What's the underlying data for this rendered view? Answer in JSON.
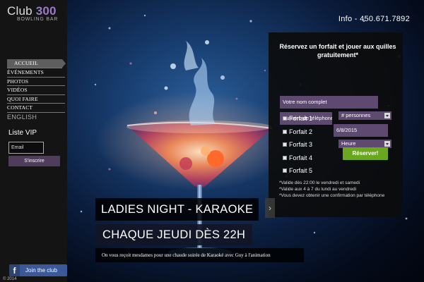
{
  "logo": {
    "name": "Club",
    "number": "300",
    "tagline": "BOWLING BAR"
  },
  "nav": {
    "items": [
      "ACCUEIL",
      "ÉVÉNEMENTS",
      "PHOTOS",
      "VIDÉOS",
      "QUOI FAIRE",
      "CONTACT"
    ],
    "english": "ENGLISH"
  },
  "vip": {
    "title": "Liste VIP",
    "email_placeholder": "Email",
    "submit": "S'inscrire"
  },
  "facebook": {
    "label": "Join the club",
    "icon": "facebook-icon"
  },
  "footer": {
    "copyright": "© 2014"
  },
  "header": {
    "info": "Info - 450.671.7892"
  },
  "reservation": {
    "title": "Réservez un forfait et jouer aux quilles gratuitement*",
    "name_placeholder": "Votre nom complet",
    "phone_placeholder": "Numéro de téléphone",
    "persons": "# personnes",
    "date": "6/8/2015",
    "hour": "Heure",
    "forfaits": [
      "Forfait 1",
      "Forfait 2",
      "Forfait 3",
      "Forfait 4",
      "Forfait 5"
    ],
    "submit": "Réserver!",
    "notes": [
      "*Valide dès 22:00 le vendredi et samedi",
      "*Valide aux 4 à 7 du lundi au vendredi",
      "*Vous devez obtenir une confirmation par téléphone"
    ]
  },
  "slide": {
    "title": "LADIES NIGHT - KARAOKE",
    "subtitle": "CHAQUE JEUDI DÈS 22H",
    "description": "On vous reçoit mesdames pour une chaude soirée de Karaoké avec Guy à l'animation",
    "next_icon": "chevron-right-icon"
  },
  "colors": {
    "accent": "#9b7bc9",
    "field": "#5e4a70",
    "button_green": "#6aa71f",
    "facebook": "#3b5998"
  }
}
